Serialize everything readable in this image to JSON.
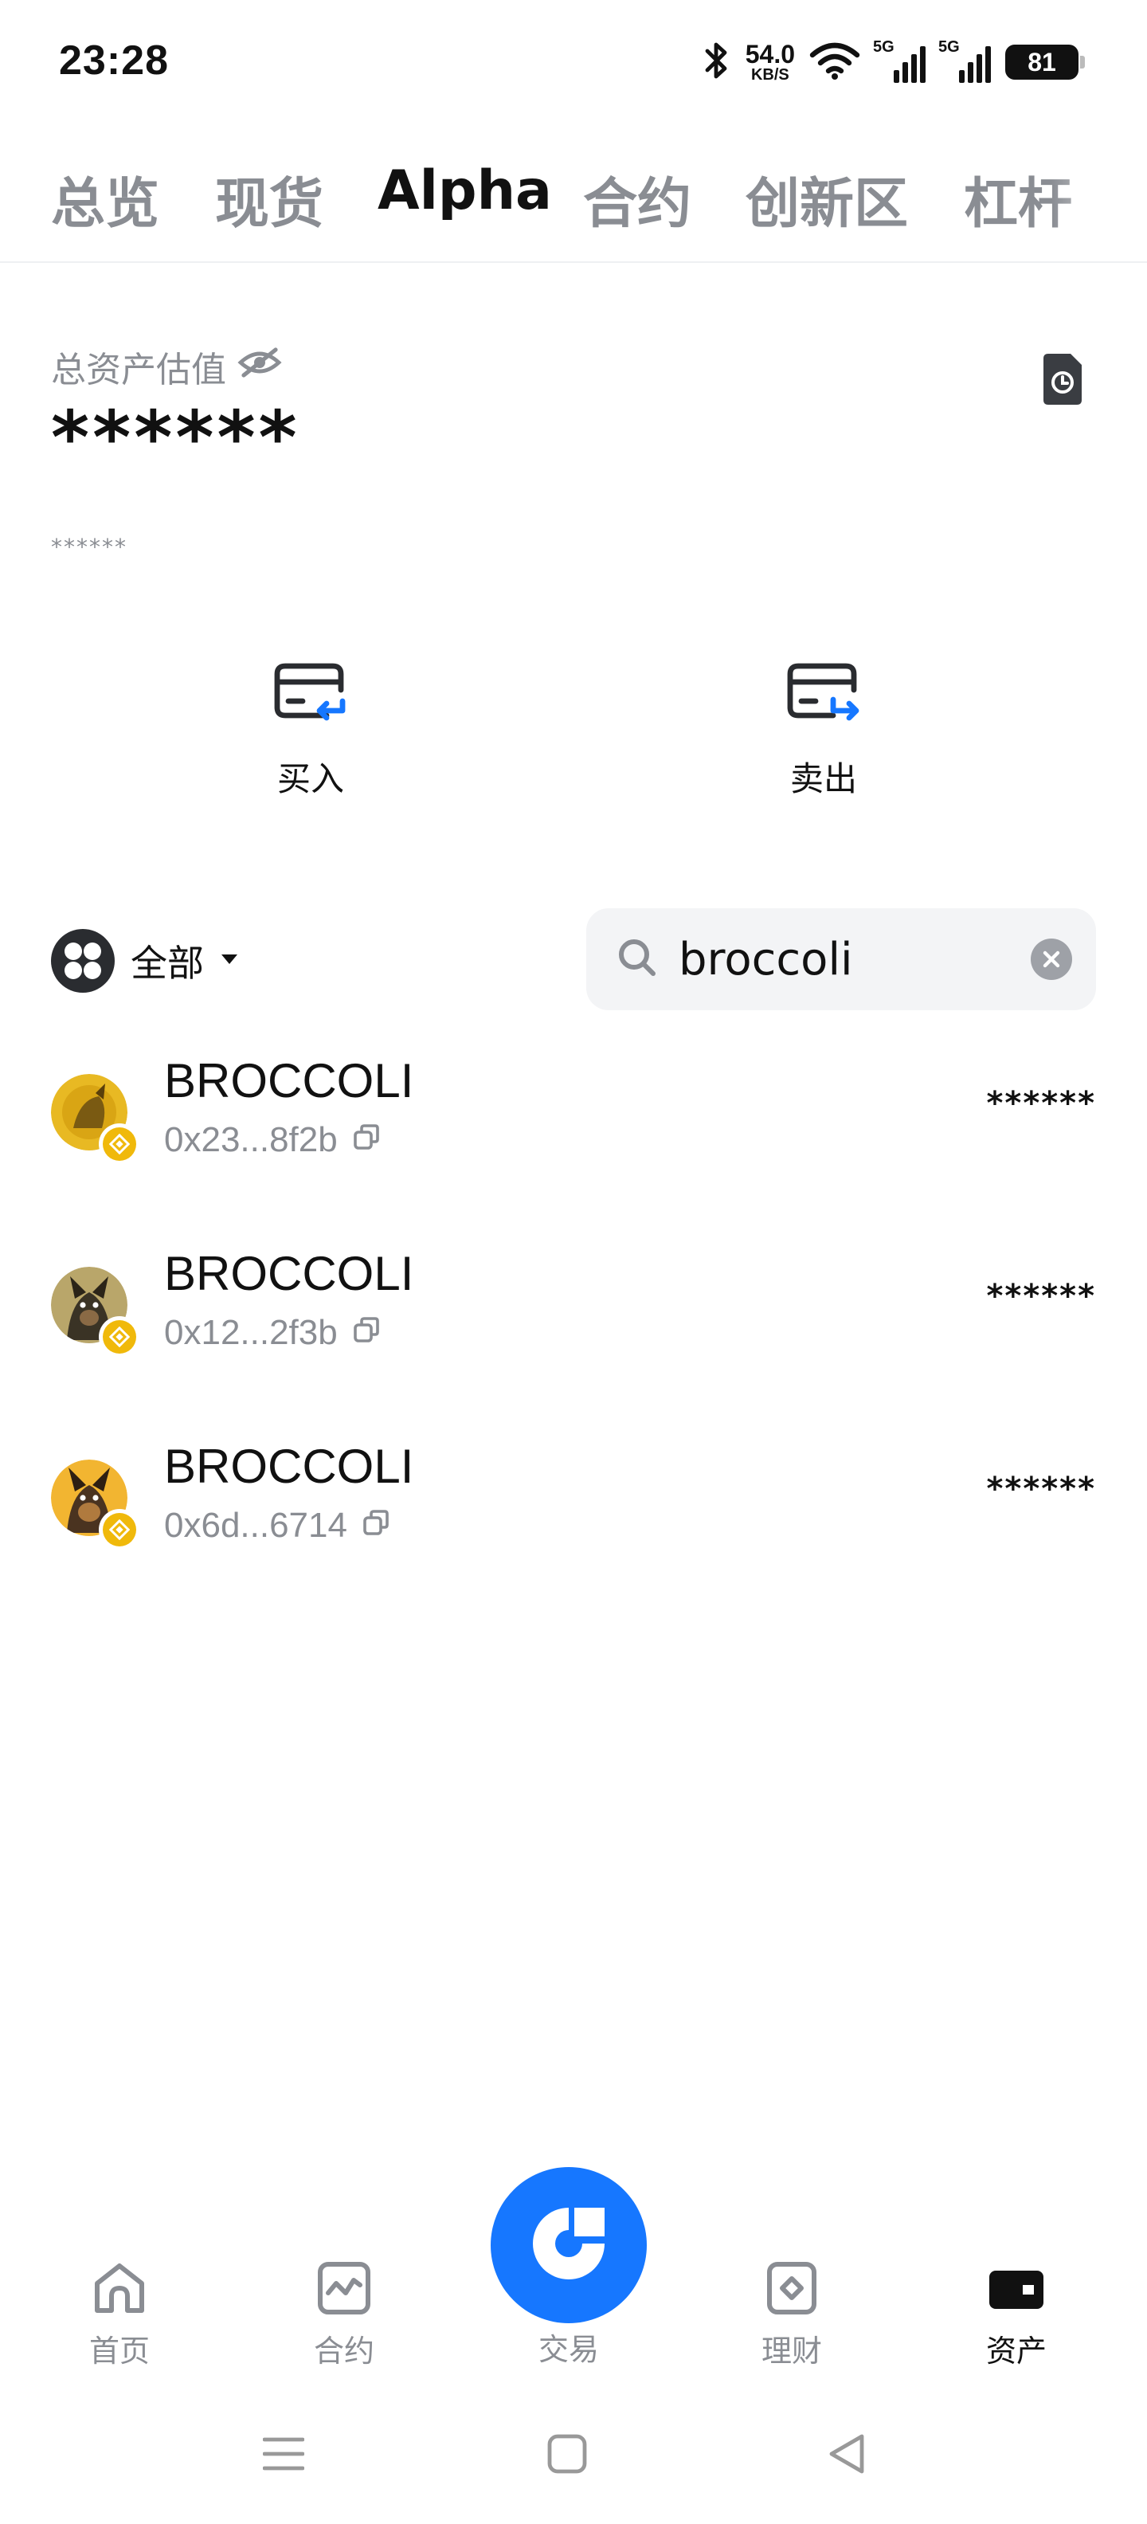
{
  "status_bar": {
    "time": "23:28",
    "net_speed_value": "54.0",
    "net_speed_unit": "KB/S",
    "signal1_tag": "5G",
    "signal2_tag": "5G",
    "battery": "81"
  },
  "top_tabs": [
    {
      "label": "总览"
    },
    {
      "label": "现货"
    },
    {
      "label": "Alpha",
      "active": true
    },
    {
      "label": "合约"
    },
    {
      "label": "创新区"
    },
    {
      "label": "杠杆"
    }
  ],
  "assets": {
    "label": "总资产估值",
    "value": "******",
    "sub_value": "******"
  },
  "actions": {
    "buy_label": "买入",
    "sell_label": "卖出"
  },
  "filter": {
    "label": "全部"
  },
  "search": {
    "value": "broccoli"
  },
  "tokens": [
    {
      "name": "BROCCOLI",
      "address": "0x23...8f2b",
      "balance": "******",
      "avatar_colors": [
        "#e8b923",
        "#7a5a12"
      ]
    },
    {
      "name": "BROCCOLI",
      "address": "0x12...2f3b",
      "balance": "******",
      "avatar_colors": [
        "#b9a66a",
        "#3a3325"
      ]
    },
    {
      "name": "BROCCOLI",
      "address": "0x6d...6714",
      "balance": "******",
      "avatar_colors": [
        "#f2b531",
        "#4a3320"
      ]
    }
  ],
  "bottom_nav": [
    {
      "label": "首页",
      "icon": "home-icon"
    },
    {
      "label": "合约",
      "icon": "futures-chart-icon"
    },
    {
      "label": "交易",
      "icon": "trade-logo-icon"
    },
    {
      "label": "理财",
      "icon": "earn-icon"
    },
    {
      "label": "资产",
      "icon": "wallet-icon",
      "active": true
    }
  ],
  "colors": {
    "accent": "#1677ff",
    "muted": "#8a8d93",
    "chain_badge": "#f0b90b"
  }
}
